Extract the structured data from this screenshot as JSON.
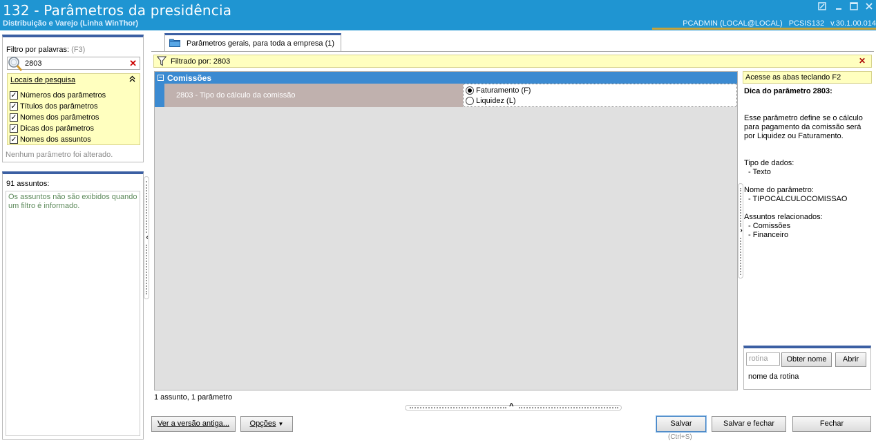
{
  "window": {
    "title": "132 - Parâmetros da presidência",
    "subtitle": "Distribuição e Varejo (Linha WinThor)",
    "user": "PCADMIN (LOCAL@LOCAL)",
    "module": "PCSIS132",
    "version": "v.30.1.00.014",
    "accent_color": "#1f95d2"
  },
  "left": {
    "filter_label": "Filtro por palavras:",
    "filter_hint": "(F3)",
    "filter_value": "2803",
    "locais_header": "Locais de pesquisa",
    "locais": [
      {
        "label": "Números dos parâmetros",
        "checked": true
      },
      {
        "label": "Títulos dos parâmetros",
        "checked": true
      },
      {
        "label": "Nomes dos parâmetros",
        "checked": true
      },
      {
        "label": "Dicas dos parâmetros",
        "checked": true
      },
      {
        "label": "Nomes dos assuntos",
        "checked": true
      }
    ],
    "status": "Nenhum parâmetro foi alterado.",
    "assuntos_label": "91 assuntos:",
    "assuntos_note": "Os assuntos não são exibidos quando um filtro é informado."
  },
  "tab": {
    "label": "Parâmetros gerais, para toda a empresa",
    "count": "(1)"
  },
  "filterbar": {
    "text": "Filtrado por: 2803"
  },
  "grid": {
    "category": "Comissões",
    "param_label": "2803 - Tipo do cálculo da comissão",
    "options": [
      {
        "label": "Faturamento (F)",
        "selected": true
      },
      {
        "label": "Liquidez (L)",
        "selected": false
      }
    ],
    "footer": "1 assunto, 1 parâmetro"
  },
  "right": {
    "acesse": "Acesse as abas teclando F2",
    "dica_title": "Dica do parâmetro 2803:",
    "dica_text": "Esse parâmetro define se o cálculo para pagamento da comissão será por Liquidez ou Faturamento.",
    "tipo_label": "Tipo de dados:",
    "tipo_value": "- Texto",
    "nome_label": "Nome do parâmetro:",
    "nome_value": "- TIPOCALCULOCOMISSAO",
    "assuntos_label": "Assuntos relacionados:",
    "assuntos_values": [
      "- Comissões",
      "- Financeiro"
    ],
    "rotina_placeholder": "rotina",
    "obter_nome": "Obter nome",
    "abrir": "Abrir",
    "nome_da_rotina": "nome da rotina"
  },
  "footer": {
    "ver_versao": "Ver a versão antiga...",
    "opcoes": "Opções",
    "salvar": "Salvar",
    "salvar_shortcut": "(Ctrl+S)",
    "salvar_fechar": "Salvar e fechar",
    "fechar": "Fechar"
  }
}
